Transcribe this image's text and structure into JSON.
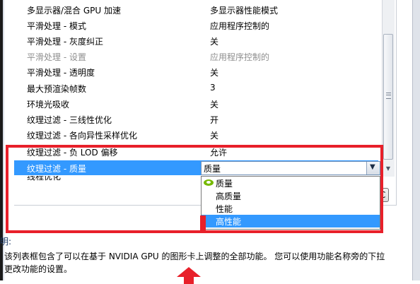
{
  "settings": {
    "rows": [
      {
        "name": "多显示器/混合 GPU 加速",
        "value": "多显示器性能模式",
        "disabled": false
      },
      {
        "name": "平滑处理 - 模式",
        "value": "应用程序控制的",
        "disabled": false
      },
      {
        "name": "平滑处理 - 灰度纠正",
        "value": "关",
        "disabled": false
      },
      {
        "name": "平滑处理 - 设置",
        "value": "应用程序控制的",
        "disabled": true
      },
      {
        "name": "平滑处理 - 透明度",
        "value": "关",
        "disabled": false
      },
      {
        "name": "最大预渲染帧数",
        "value": "3",
        "disabled": false
      },
      {
        "name": "环境光吸收",
        "value": "关",
        "disabled": false
      },
      {
        "name": "纹理过滤 - 三线性优化",
        "value": "开",
        "disabled": false
      },
      {
        "name": "纹理过滤 - 各向异性采样优化",
        "value": "关",
        "disabled": false
      },
      {
        "name": "纹理过滤 - 负 LOD 偏移",
        "value": "允许",
        "disabled": false
      },
      {
        "name": "纹理过滤 - 质量",
        "value": "",
        "disabled": false,
        "selected": true
      },
      {
        "name": "线程优化",
        "value": "",
        "disabled": false
      }
    ]
  },
  "combo": {
    "selected": "质量",
    "options": [
      "质量",
      "高质量",
      "性能",
      "高性能"
    ],
    "highlighted": "高性能"
  },
  "hidden_button": {
    "label": "C"
  },
  "description": {
    "label": "明:",
    "line1": "该列表框包含了可以在基于 NVIDIA GPU 的图形卡上调整的全部功能。 您可以使用功能名称旁的下拉",
    "line2": "更改功能的设置。"
  },
  "colors": {
    "annotation_red": "#e8202a",
    "selection_blue": "#3399ff",
    "nvidia_green": "#76b900"
  }
}
